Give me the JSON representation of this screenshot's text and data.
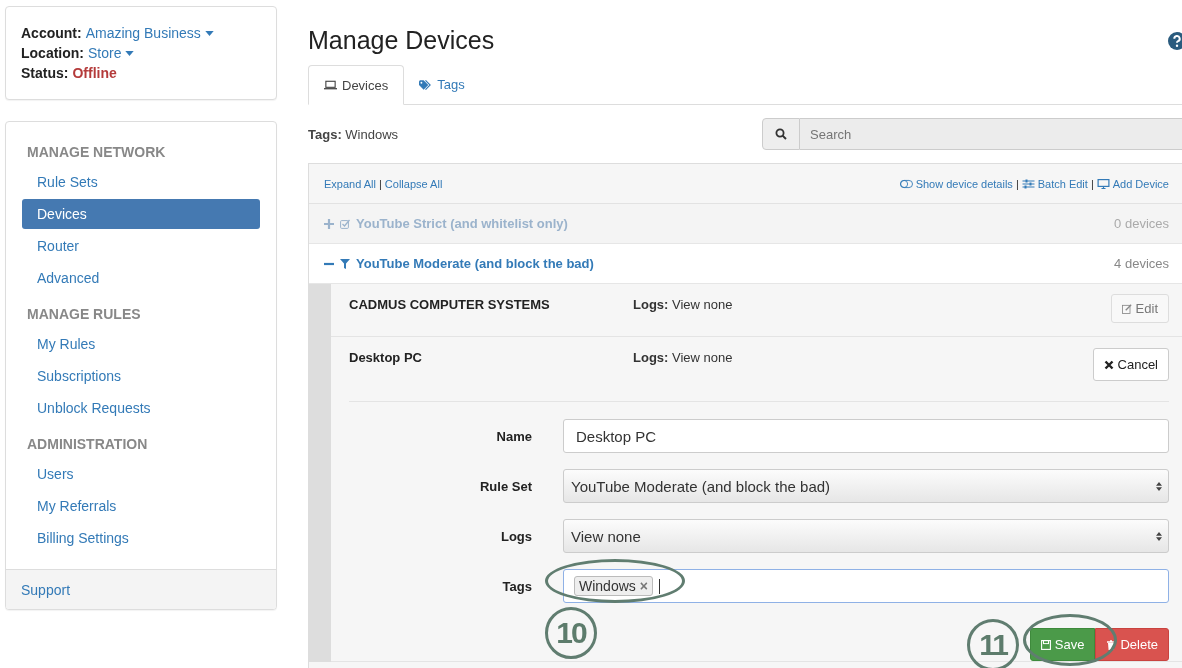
{
  "account": [
    {
      "label": "Account:",
      "value": "Amazing Business",
      "kind": "dropdown"
    },
    {
      "label": "Location:",
      "value": "Store",
      "kind": "dropdown"
    },
    {
      "label": "Status:",
      "value": "Offline",
      "kind": "status"
    }
  ],
  "sidebar": {
    "sections": [
      {
        "heading": "MANAGE NETWORK",
        "items": [
          {
            "label": "Rule Sets",
            "selected": false
          },
          {
            "label": "Devices",
            "selected": true
          },
          {
            "label": "Router",
            "selected": false
          },
          {
            "label": "Advanced",
            "selected": false
          }
        ]
      },
      {
        "heading": "MANAGE RULES",
        "items": [
          {
            "label": "My Rules",
            "selected": false
          },
          {
            "label": "Subscriptions",
            "selected": false
          },
          {
            "label": "Unblock Requests",
            "selected": false
          }
        ]
      },
      {
        "heading": "ADMINISTRATION",
        "items": [
          {
            "label": "Users",
            "selected": false
          },
          {
            "label": "My Referrals",
            "selected": false
          },
          {
            "label": "Billing Settings",
            "selected": false
          }
        ]
      }
    ],
    "footer": "Support"
  },
  "page_title": "Manage Devices",
  "tabs": [
    {
      "label": "Devices",
      "selected": true
    },
    {
      "label": "Tags",
      "selected": false
    }
  ],
  "tag_filter": {
    "label": "Tags:",
    "value": "Windows"
  },
  "search": {
    "placeholder": "Search"
  },
  "toolbar": {
    "separator": "|",
    "left": [
      "Expand All",
      "Collapse All"
    ],
    "right": [
      {
        "label": "Show device details"
      },
      {
        "label": "Batch Edit"
      },
      {
        "label": "Add Device"
      }
    ]
  },
  "groups": [
    {
      "name": "YouTube Strict (and whitelist only)",
      "expanded": false,
      "dimmed": true,
      "count": "0 devices"
    },
    {
      "name": "YouTube Moderate (and block the bad)",
      "expanded": true,
      "dimmed": false,
      "count": "4 devices",
      "devices": [
        {
          "name": "CADMUS COMPUTER SYSTEMS",
          "logs_label": "Logs:",
          "logs_value": "View none",
          "editing": false,
          "action": "Edit"
        },
        {
          "name": "Desktop PC",
          "logs_label": "Logs:",
          "logs_value": "View none",
          "editing": true,
          "action": "Cancel"
        }
      ]
    }
  ],
  "form": {
    "fields": [
      {
        "kind": "text",
        "label": "Name",
        "value": "Desktop PC"
      },
      {
        "kind": "select",
        "label": "Rule Set",
        "value": "YouTube Moderate (and block the bad)"
      },
      {
        "kind": "select",
        "label": "Logs",
        "value": "View none"
      },
      {
        "kind": "tags",
        "label": "Tags",
        "tags": [
          "Windows"
        ],
        "remove": "×"
      }
    ],
    "save": "Save",
    "delete": "Delete"
  },
  "callouts": [
    "10",
    "11"
  ]
}
